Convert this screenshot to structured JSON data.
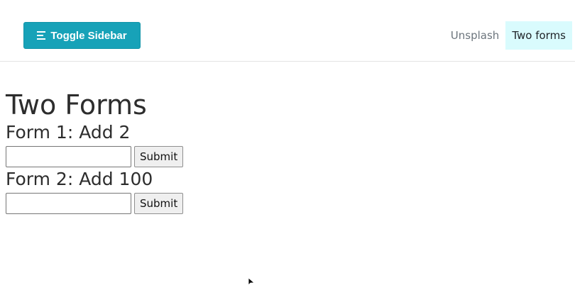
{
  "navbar": {
    "toggle_label": "Toggle Sidebar",
    "toggle_icon": "list-icon",
    "links": [
      {
        "label": "Unsplash",
        "active": false
      },
      {
        "label": "Two forms",
        "active": true
      }
    ],
    "accent_color": "#17a2b8",
    "active_link_bg": "#d9fbfd"
  },
  "main": {
    "title": "Two Forms",
    "forms": [
      {
        "heading": "Form 1: Add 2",
        "input_value": "",
        "submit_label": "Submit"
      },
      {
        "heading": "Form 2: Add 100",
        "input_value": "",
        "submit_label": "Submit"
      }
    ]
  }
}
